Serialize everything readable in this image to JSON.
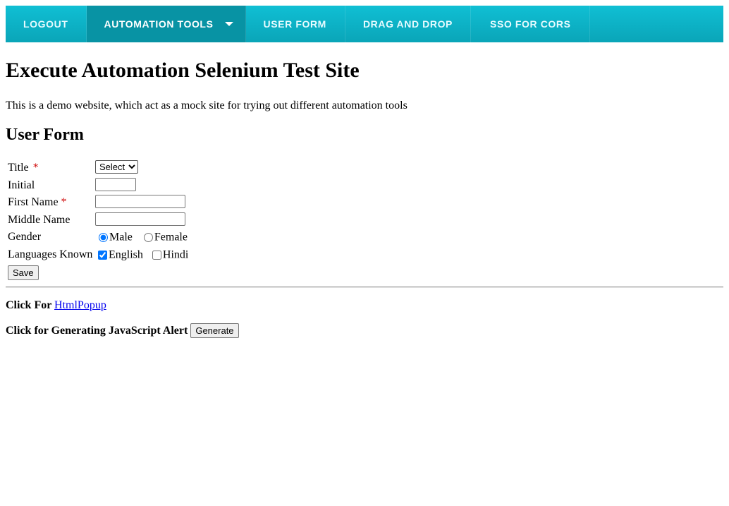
{
  "nav": {
    "items": [
      {
        "label": "LOGOUT"
      },
      {
        "label": "AUTOMATION TOOLS"
      },
      {
        "label": "USER FORM"
      },
      {
        "label": "DRAG AND DROP"
      },
      {
        "label": "SSO FOR CORS"
      }
    ],
    "active_index": 1,
    "caret_icon": "chevron-down-icon"
  },
  "page": {
    "title": "Execute Automation Selenium Test Site",
    "intro": "This is a demo website, which act as a mock site for trying out different automation tools"
  },
  "form": {
    "heading": "User Form",
    "title_label": "Title",
    "title_select_value": "Select",
    "initial_label": "Initial",
    "initial_value": "",
    "first_name_label": "First Name",
    "first_name_value": "",
    "middle_name_label": "Middle Name",
    "middle_name_value": "",
    "required_mark": "*",
    "gender_label": "Gender",
    "gender_options": [
      "Male",
      "Female"
    ],
    "gender_selected": "Male",
    "languages_label": "Languages Known",
    "language_options": [
      "English",
      "Hindi"
    ],
    "languages_checked": [
      "English"
    ],
    "save_label": "Save"
  },
  "links": {
    "popup_prefix": "Click For",
    "popup_link": "HtmlPopup ",
    "alert_prefix": "Click for Generating JavaScript Alert",
    "generate_label": "Generate"
  },
  "colors": {
    "nav_bg": "#0aa5b8",
    "nav_active": "#0893a4",
    "required": "#d01010",
    "link": "#0000ee"
  }
}
